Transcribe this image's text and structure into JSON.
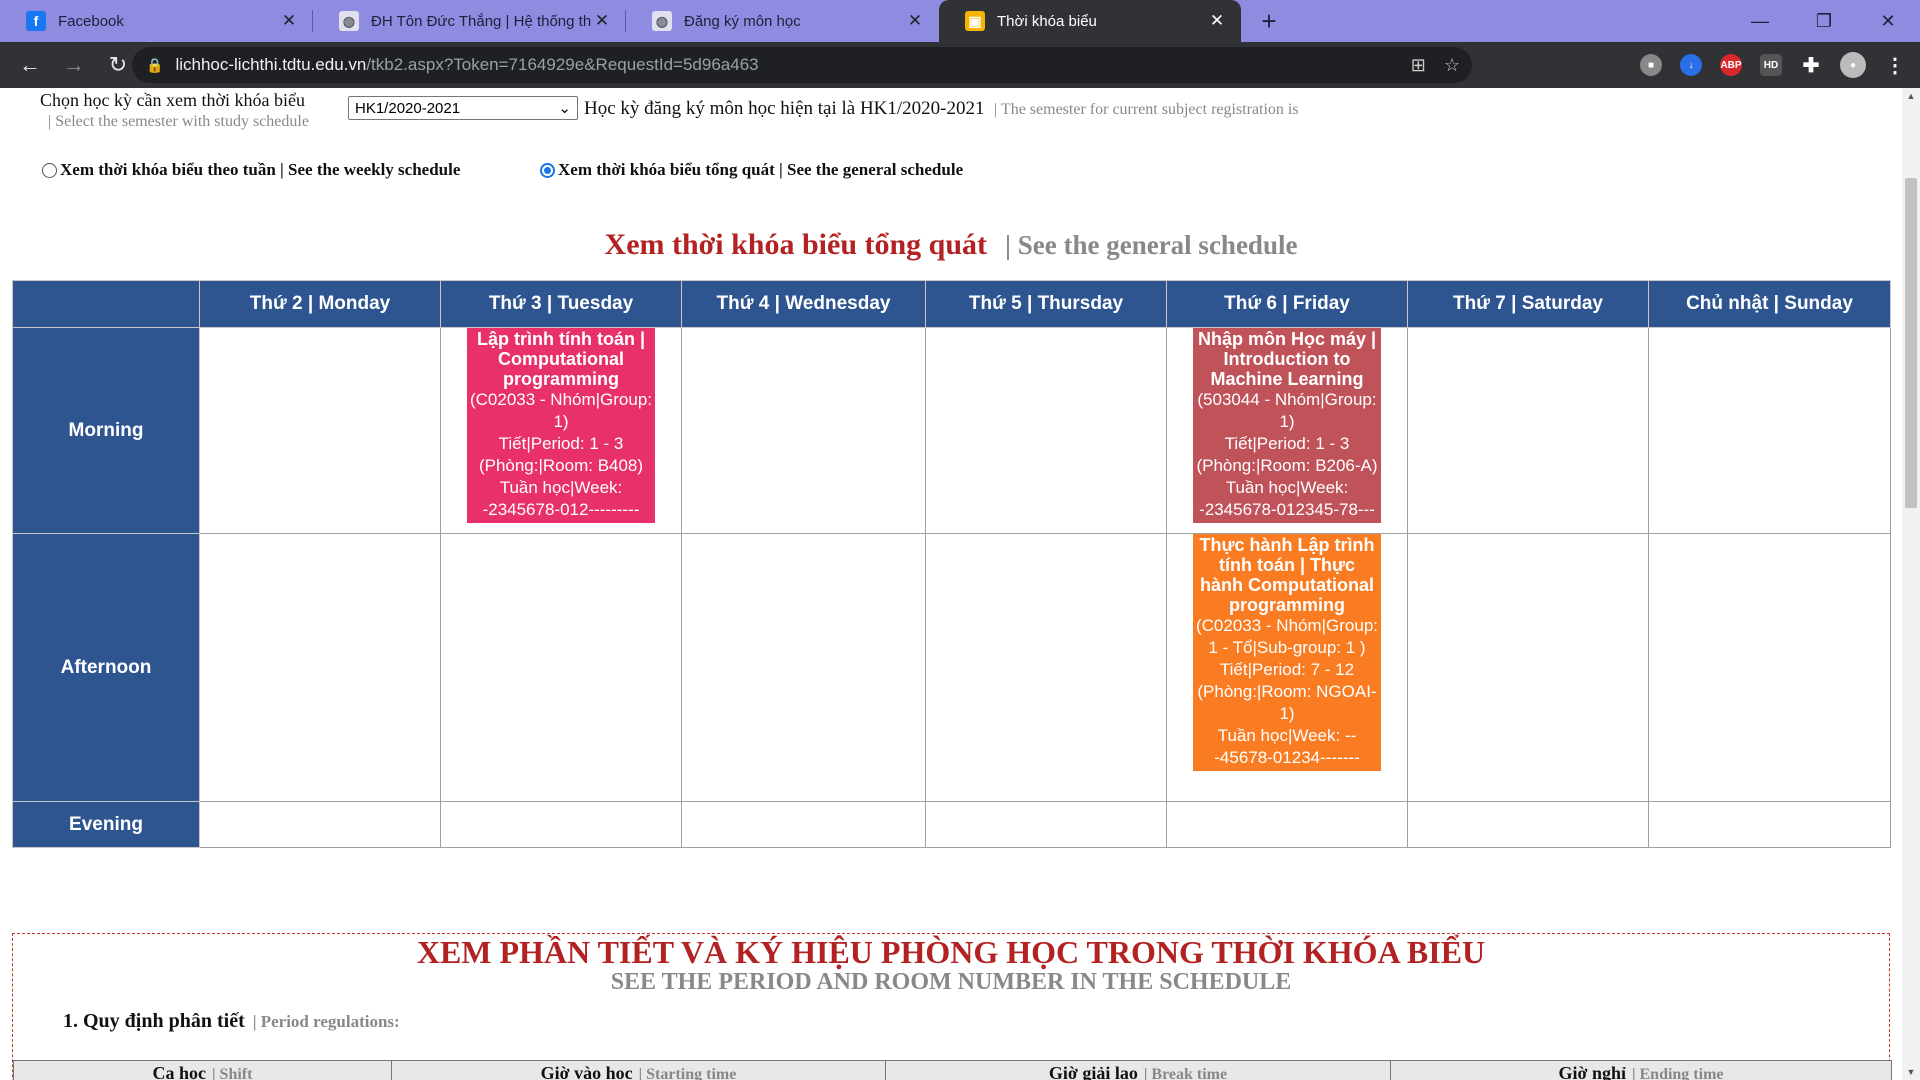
{
  "browser": {
    "tabs": [
      {
        "title": "Facebook",
        "icon": "facebook-icon",
        "color": "#1877f2"
      },
      {
        "title": "ĐH Tôn Đức Thắng | Hệ thống th",
        "icon": "globe-icon",
        "color": "#5f6368"
      },
      {
        "title": "Đăng ký môn học",
        "icon": "globe-icon",
        "color": "#5f6368"
      },
      {
        "title": "Thời khóa biểu",
        "icon": "gift-icon",
        "color": "#f4b400"
      }
    ],
    "url_host": "lichhoc-lichthi.tdtu.edu.vn",
    "url_path": "/tkb2.aspx?Token=7164929e&RequestId=5d96a463"
  },
  "page": {
    "semester_label": "Chọn học kỳ cần xem thời khóa biểu",
    "semester_label_en": "| Select the semester with study schedule",
    "semester_selected": "HK1/2020-2021",
    "current_semester": "Học kỳ đăng ký môn học hiện tại là HK1/2020-2021",
    "current_semester_en": "| The semester for current subject registration is",
    "radio_weekly": "Xem thời khóa biểu theo tuần | See the weekly schedule",
    "radio_general": "Xem thời khóa biểu tổng quát | See the general schedule",
    "schedule_title": "Xem thời khóa biểu tổng quát",
    "schedule_title_en": "| See the general schedule"
  },
  "schedule": {
    "days": [
      "Thứ 2 | Monday",
      "Thứ 3 | Tuesday",
      "Thứ 4 | Wednesday",
      "Thứ 5 | Thursday",
      "Thứ 6 | Friday",
      "Thứ 7 | Saturday",
      "Chủ nhật | Sunday"
    ],
    "sessions": [
      "Morning",
      "Afternoon",
      "Evening"
    ],
    "classes": [
      {
        "name": "Lập trình tính toán | Computational programming",
        "code": "(C02033 - Nhóm|Group: 1)",
        "period": "Tiết|Period: 1 - 3",
        "room": "(Phòng:|Room: B408)",
        "week_label": "Tuần học|Week:",
        "weeks": "-2345678-012---------",
        "color": "#e8306a"
      },
      {
        "name": "Nhập môn Học máy | Introduction to Machine Learning",
        "code": "(503044 - Nhóm|Group: 1)",
        "period": "Tiết|Period: 1 - 3",
        "room": "(Phòng:|Room: B206-A)",
        "week_label": "Tuần học|Week:",
        "weeks": "-2345678-012345-78---",
        "color": "#c0525a"
      },
      {
        "name": "Thực hành Lập trình tính toán | Thực hành Computational programming",
        "code": "(C02033 - Nhóm|Group: 1 - Tổ|Sub-group: 1 )",
        "period": "Tiết|Period: 7 - 12",
        "room": "(Phòng:|Room: NGOAI-1)",
        "week_label": "Tuần học|Week: --",
        "weeks": "-45678-01234-------",
        "color": "#fa7c22"
      }
    ]
  },
  "details": {
    "title": "XEM PHẦN TIẾT VÀ KÝ HIỆU PHÒNG HỌC TRONG THỜI KHÓA BIỂU",
    "title_en": "SEE THE PERIOD AND ROOM NUMBER IN THE SCHEDULE",
    "rule_title": "1. Quy định phân tiết",
    "rule_title_en": "| Period regulations:",
    "col_ca": "Ca học",
    "col_ca_en": "| Shift",
    "col_start": "Giờ vào học",
    "col_start_en": "| Starting time",
    "col_break": "Giờ giải lao",
    "col_break_en": "| Break time",
    "col_end": "Giờ nghỉ",
    "col_end_en": "| Ending time"
  }
}
